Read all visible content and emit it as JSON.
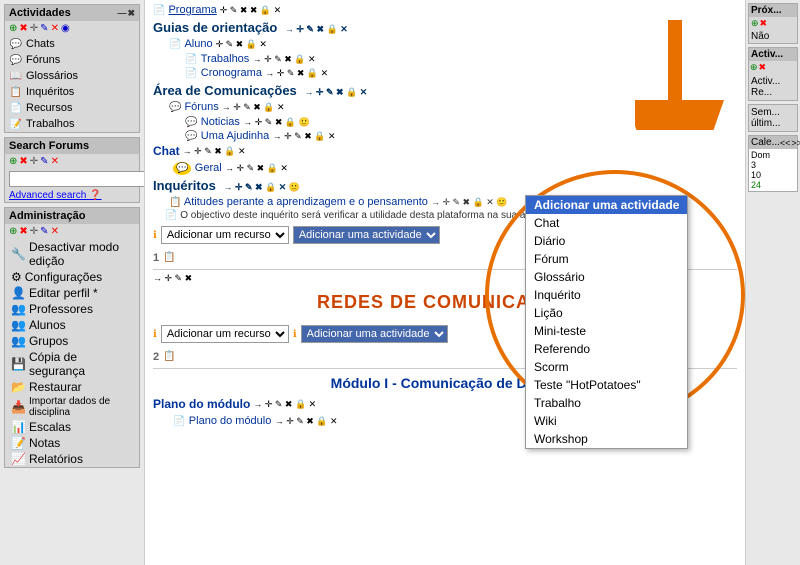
{
  "sidebar": {
    "actividades_header": "Actividades",
    "items": [
      {
        "label": "Chats",
        "icon": "💬"
      },
      {
        "label": "Fóruns",
        "icon": "💬"
      },
      {
        "label": "Glossários",
        "icon": "📖"
      },
      {
        "label": "Inquéritos",
        "icon": "📋"
      },
      {
        "label": "Recursos",
        "icon": "📄"
      },
      {
        "label": "Trabalhos",
        "icon": "📝"
      }
    ],
    "search_header": "Search Forums",
    "search_placeholder": "",
    "search_btn": ">",
    "advanced_search": "Advanced search",
    "admin_header": "Administração",
    "admin_items": [
      {
        "label": "Desactivar modo edição"
      },
      {
        "label": "Configurações"
      },
      {
        "label": "Editar perfil *"
      },
      {
        "label": "Professores"
      },
      {
        "label": "Alunos"
      },
      {
        "label": "Grupos"
      },
      {
        "label": "Cópia de segurança"
      },
      {
        "label": "Restaurar"
      },
      {
        "label": "Importar dados de disciplina"
      },
      {
        "label": "Escalas"
      },
      {
        "label": "Notas"
      },
      {
        "label": "Relatórios"
      }
    ]
  },
  "main": {
    "guias_title": "Guias de orientação",
    "aluno_label": "Aluno",
    "trabalhos_label": "Trabalhos",
    "cronograma_label": "Cronograma",
    "area_title": "Área de Comunicações",
    "foruns_label": "Fóruns",
    "noticias_label": "Noticias",
    "uma_ajudinha_label": "Uma Ajudinha",
    "chat_label": "Chat",
    "geral_label": "Geral",
    "inqueritos_title": "Inquéritos",
    "inquerito_item1": "Atitudes perante a aprendizagem e o pensamento",
    "inquerito_item2": "O objectivo deste inquérito será verificar a utilidade desta plataforma na sua aprendizagem",
    "add_resource_label": "Adicionar um recurso",
    "section1_number": "1",
    "big_title": "REDES DE COMUNICAÇÃO",
    "section2_number": "2",
    "module_title": "Módulo I - Comunicação de Dados",
    "plano_modulo_label": "Plano do módulo",
    "plano_modulo_sub": "Plano do módulo",
    "add_activity_label": "Adicionar uma actividade",
    "programa_label": "Programa"
  },
  "dropdown": {
    "items": [
      {
        "label": "Adicionar uma actividade",
        "selected": true
      },
      {
        "label": "Chat"
      },
      {
        "label": "Diário"
      },
      {
        "label": "Fórum"
      },
      {
        "label": "Glossário"
      },
      {
        "label": "Inquérito"
      },
      {
        "label": "Lição"
      },
      {
        "label": "Mini-teste"
      },
      {
        "label": "Referendo"
      },
      {
        "label": "Scorm"
      },
      {
        "label": "Teste \"HotPotatoes\""
      },
      {
        "label": "Trabalho"
      },
      {
        "label": "Wiki"
      },
      {
        "label": "Workshop"
      }
    ]
  },
  "right_sidebar": {
    "prox_header": "Próx...",
    "nao_label": "Não",
    "activ_header": "Activ...",
    "activ_content": "Activ...",
    "re_label": "Re...",
    "sem_label": "Sem...",
    "ultim_label": "últim...",
    "cale_header": "Cale...",
    "dom_label": "Dom",
    "days": [
      "3",
      "10",
      "24"
    ],
    "nav_prev": "<<",
    "nav_next": ">>"
  },
  "icons": {
    "move": "✛",
    "edit": "✎",
    "delete": "✖",
    "eye": "👁",
    "arrow_right": "→",
    "arrow_left": "←",
    "chat_bubble": "💬",
    "page": "📄",
    "book": "📖",
    "pencil": "✏"
  }
}
